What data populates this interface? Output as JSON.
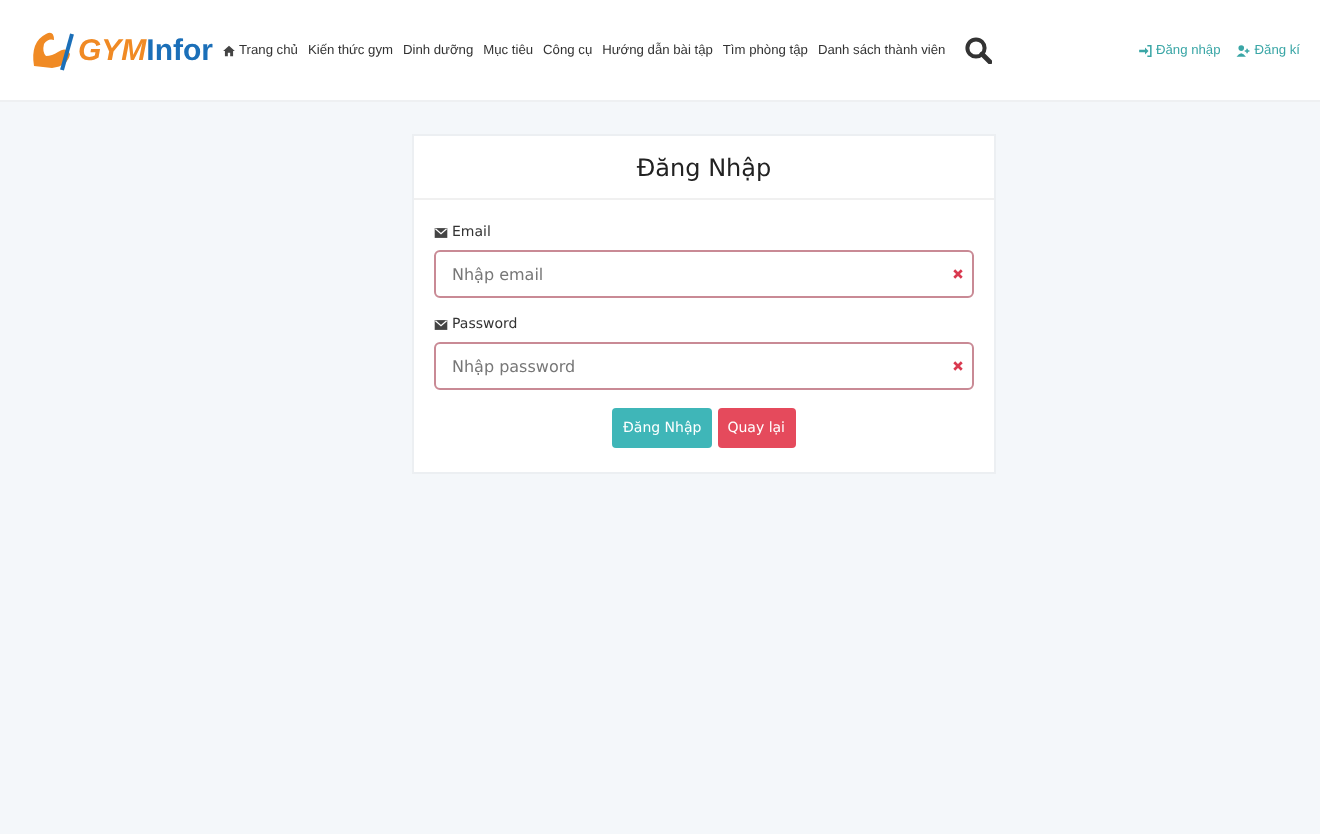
{
  "logo": {
    "text_a": "GYM",
    "text_b": "Infor"
  },
  "nav": [
    {
      "label": "Trang chủ",
      "kind": "home"
    },
    {
      "label": "Kiến thức gym"
    },
    {
      "label": "Dinh dưỡng"
    },
    {
      "label": "Mục tiêu"
    },
    {
      "label": "Công cụ"
    },
    {
      "label": "Hướng dẫn bài tập"
    },
    {
      "label": "Tìm phòng tập"
    },
    {
      "label": "Danh sách thành viên"
    }
  ],
  "auth_links": [
    {
      "label": "Đăng nhập",
      "kind": "signin"
    },
    {
      "label": "Đăng kí",
      "kind": "signup"
    }
  ],
  "login": {
    "title": "Đăng Nhập",
    "fields": [
      {
        "label": "Email",
        "placeholder": "Nhập email",
        "invalid": true
      },
      {
        "label": "Password",
        "placeholder": "Nhập password",
        "invalid": true
      }
    ],
    "buttons": [
      {
        "label": "Đăng Nhập",
        "kind": "primary"
      },
      {
        "label": "Quay lại",
        "kind": "danger"
      }
    ]
  }
}
